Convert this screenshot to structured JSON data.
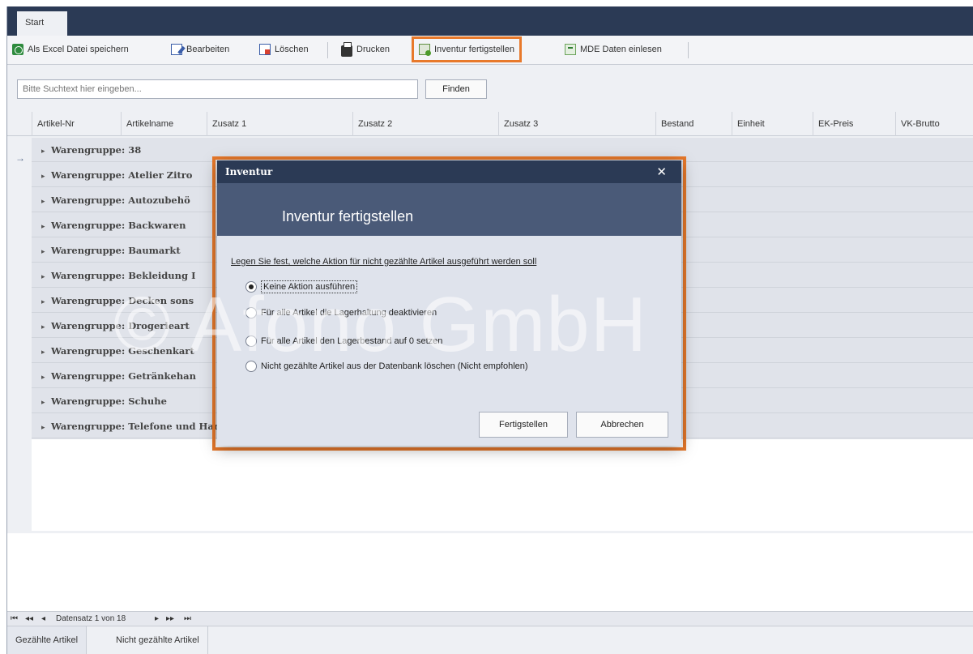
{
  "ribbon": {
    "tabs": [
      {
        "label": "Start"
      }
    ]
  },
  "toolbar": {
    "excel_label": "Als Excel Datei speichern",
    "edit_label": "Bearbeiten",
    "delete_label": "Löschen",
    "print_label": "Drucken",
    "inventory_label": "Inventur fertigstellen",
    "mde_label": "MDE Daten einlesen"
  },
  "search": {
    "placeholder": "Bitte Suchtext hier eingeben...",
    "find_label": "Finden"
  },
  "grid": {
    "columns": [
      "Artikel-Nr",
      "Artikelname",
      "Zusatz 1",
      "Zusatz 2",
      "Zusatz 3",
      "Bestand",
      "Einheit",
      "EK-Preis",
      "VK-Brutto"
    ],
    "groups": [
      "Warengruppe: 38",
      "Warengruppe: Atelier Zitro",
      "Warengruppe: Autozubehö",
      "Warengruppe: Backwaren",
      "Warengruppe: Baumarkt",
      "Warengruppe: Bekleidung I",
      "Warengruppe: Decken sons",
      "Warengruppe: Drogerieart",
      "Warengruppe: Geschenkart",
      "Warengruppe: Getränkehan",
      "Warengruppe: Schuhe",
      "Warengruppe: Telefone und Handys"
    ],
    "current_row_indicator": "→"
  },
  "navigator": {
    "first": "⏮",
    "prev_page": "◂◂",
    "prev": "◂",
    "record_text": "Datensatz 1 von 18",
    "next": "▸",
    "next_page": "▸▸",
    "last": "⏭"
  },
  "bottom_tabs": [
    {
      "label": "Gezählte Artikel"
    },
    {
      "label": "Nicht gezählte Artikel"
    }
  ],
  "dialog": {
    "window_title": "Inventur",
    "close_glyph": "✕",
    "header_title": "Inventur fertigstellen",
    "instruction": "Legen Sie fest, welche Aktion für nicht gezählte Artikel ausgeführt werden soll",
    "options": [
      {
        "label": "Keine Aktion ausführen",
        "checked": true
      },
      {
        "label": "Für alle Artikel die Lagerhaltung deaktivieren",
        "checked": false
      },
      {
        "label": "Für alle Artikel den Lagerbestand auf 0 setzen",
        "checked": false
      },
      {
        "label": "Nicht gezählte Artikel aus der Datenbank löschen (Nicht empfohlen)",
        "checked": false
      }
    ],
    "confirm_label": "Fertigstellen",
    "cancel_label": "Abbrechen"
  },
  "watermark": "© Afono GmbH",
  "colors": {
    "accent_highlight": "#e8792b",
    "titlebar": "#2b3a55",
    "dialog_header": "#4a5a78"
  }
}
